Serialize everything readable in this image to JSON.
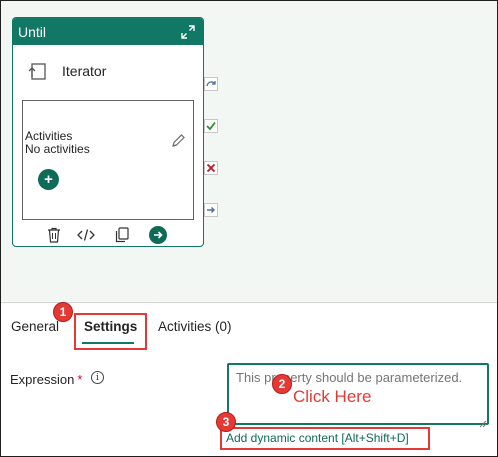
{
  "canvas": {
    "until": {
      "title": "Until",
      "iterator_label": "Iterator",
      "activities_title": "Activities",
      "activities_empty": "No activities"
    }
  },
  "tabs": [
    {
      "label": "General"
    },
    {
      "label": "Settings",
      "selected": true
    },
    {
      "label": "Activities (0)"
    }
  ],
  "settings": {
    "expression_label": "Expression",
    "required_mark": "*",
    "expression_placeholder": "This property should be parameterized.",
    "dynamic_content_link": "Add dynamic content [Alt+Shift+D]"
  },
  "annotations": {
    "badges": [
      "1",
      "2",
      "3"
    ],
    "click_here": "Click Here",
    "highlight_color": "#e53935"
  },
  "colors": {
    "accent": "#117865",
    "canvas_bg": "#f3f7f3",
    "success": "#2e8b2e",
    "failure": "#c4102b"
  },
  "icons": [
    "expand-icon",
    "iterator-icon",
    "pencil-icon",
    "add-icon",
    "delete-icon",
    "code-icon",
    "copy-icon",
    "go-arrow-icon",
    "skip-connector-icon",
    "success-connector-icon",
    "failure-connector-icon",
    "completion-connector-icon",
    "info-icon"
  ]
}
